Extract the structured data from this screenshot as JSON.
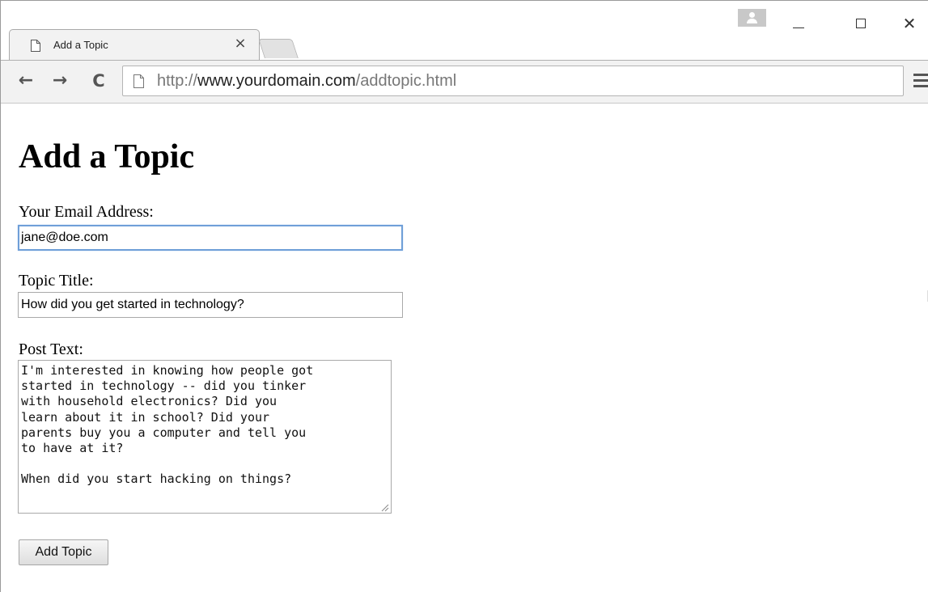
{
  "browser": {
    "tab": {
      "title": "Add a Topic",
      "close_glyph": "×",
      "icon": "page-icon"
    },
    "window_controls": {
      "close_glyph": "✕"
    },
    "toolbar": {
      "back_glyph": "←",
      "forward_glyph": "→",
      "reload_glyph": "C",
      "url_scheme": "http://",
      "url_host": "www.yourdomain.com",
      "url_path": "/addtopic.html"
    }
  },
  "page": {
    "title": "Add a Topic",
    "form": {
      "email": {
        "label": "Your Email Address:",
        "value": "jane@doe.com"
      },
      "topic_title": {
        "label": "Topic Title:",
        "value": "How did you get started in technology?"
      },
      "post_text": {
        "label": "Post Text:",
        "value": "I'm interested in knowing how people got\nstarted in technology -- did you tinker\nwith household electronics? Did you\nlearn about it in school? Did your\nparents buy you a computer and tell you\nto have at it?\n\nWhen did you start hacking on things?"
      },
      "submit_label": "Add Topic"
    }
  },
  "colors": {
    "focus_border": "#6f9fd8",
    "chrome_bg": "#f2f2f2"
  }
}
